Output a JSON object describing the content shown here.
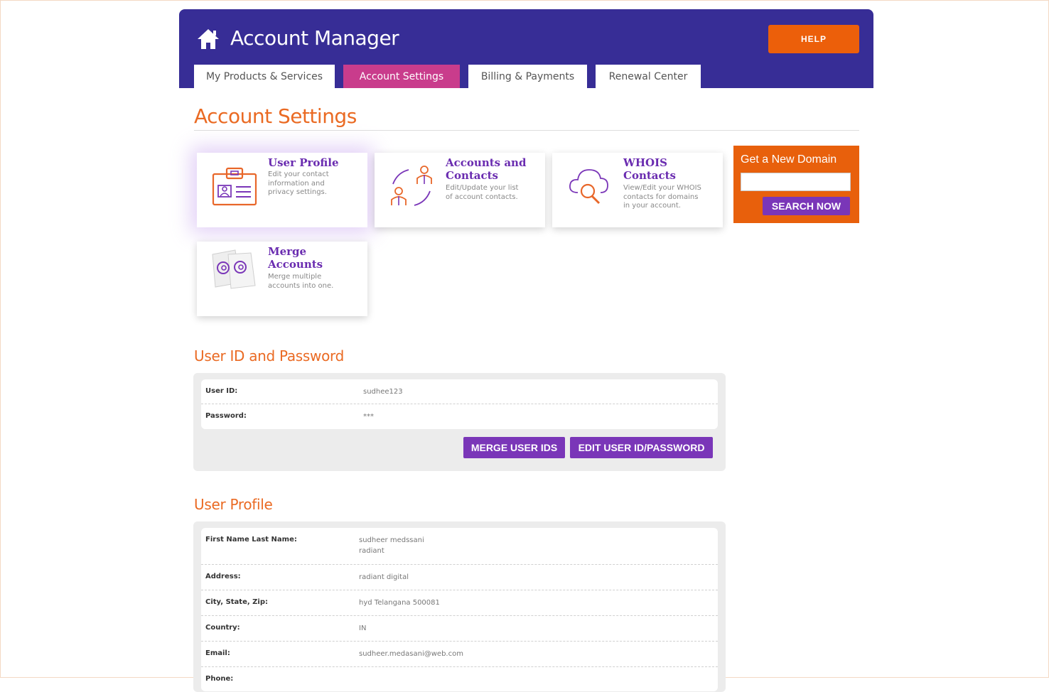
{
  "header": {
    "title": "Account Manager",
    "help_label": "HELP",
    "home_icon": "home-icon"
  },
  "tabs": [
    {
      "label": "My Products & Services",
      "active": false
    },
    {
      "label": "Account Settings",
      "active": true
    },
    {
      "label": "Billing & Payments",
      "active": false
    },
    {
      "label": "Renewal Center",
      "active": false
    }
  ],
  "page": {
    "title": "Account Settings"
  },
  "cards": [
    {
      "title": "User Profile",
      "desc": "Edit your contact information and privacy settings.",
      "icon": "id-card-icon"
    },
    {
      "title": "Accounts and Contacts",
      "desc": "Edit/Update your list of account contacts.",
      "icon": "contacts-exchange-icon"
    },
    {
      "title": "WHOIS Contacts",
      "desc": "View/Edit your WHOIS contacts for domains in your account.",
      "icon": "cloud-search-icon"
    },
    {
      "title": "Merge Accounts",
      "desc": "Merge multiple accounts into one.",
      "icon": "merge-at-icon"
    }
  ],
  "domain": {
    "title": "Get a New Domain",
    "input_value": "",
    "button_label": "SEARCH NOW"
  },
  "credentials": {
    "section_title": "User ID and Password",
    "rows": [
      {
        "label": "User ID:",
        "value": "sudhee123"
      },
      {
        "label": "Password:",
        "value": "***"
      }
    ],
    "merge_label": "MERGE USER IDS",
    "edit_label": "EDIT USER ID/PASSWORD"
  },
  "profile": {
    "section_title": "User Profile",
    "rows": [
      {
        "label": "First Name Last Name:",
        "value": "sudheer medssani",
        "value2": "radiant"
      },
      {
        "label": "Address:",
        "value": "radiant digital"
      },
      {
        "label": "City, State, Zip:",
        "value": "hyd  Telangana  500081"
      },
      {
        "label": "Country:",
        "value": "IN"
      },
      {
        "label": "Email:",
        "value": "sudheer.medasani@web.com"
      },
      {
        "label": "Phone:",
        "value": ""
      }
    ]
  },
  "colors": {
    "header_bg": "#372d96",
    "accent_orange": "#ea6a23",
    "active_tab": "#c93c8c",
    "button_purple": "#7a36b8",
    "help_orange": "#ec5f0a"
  }
}
